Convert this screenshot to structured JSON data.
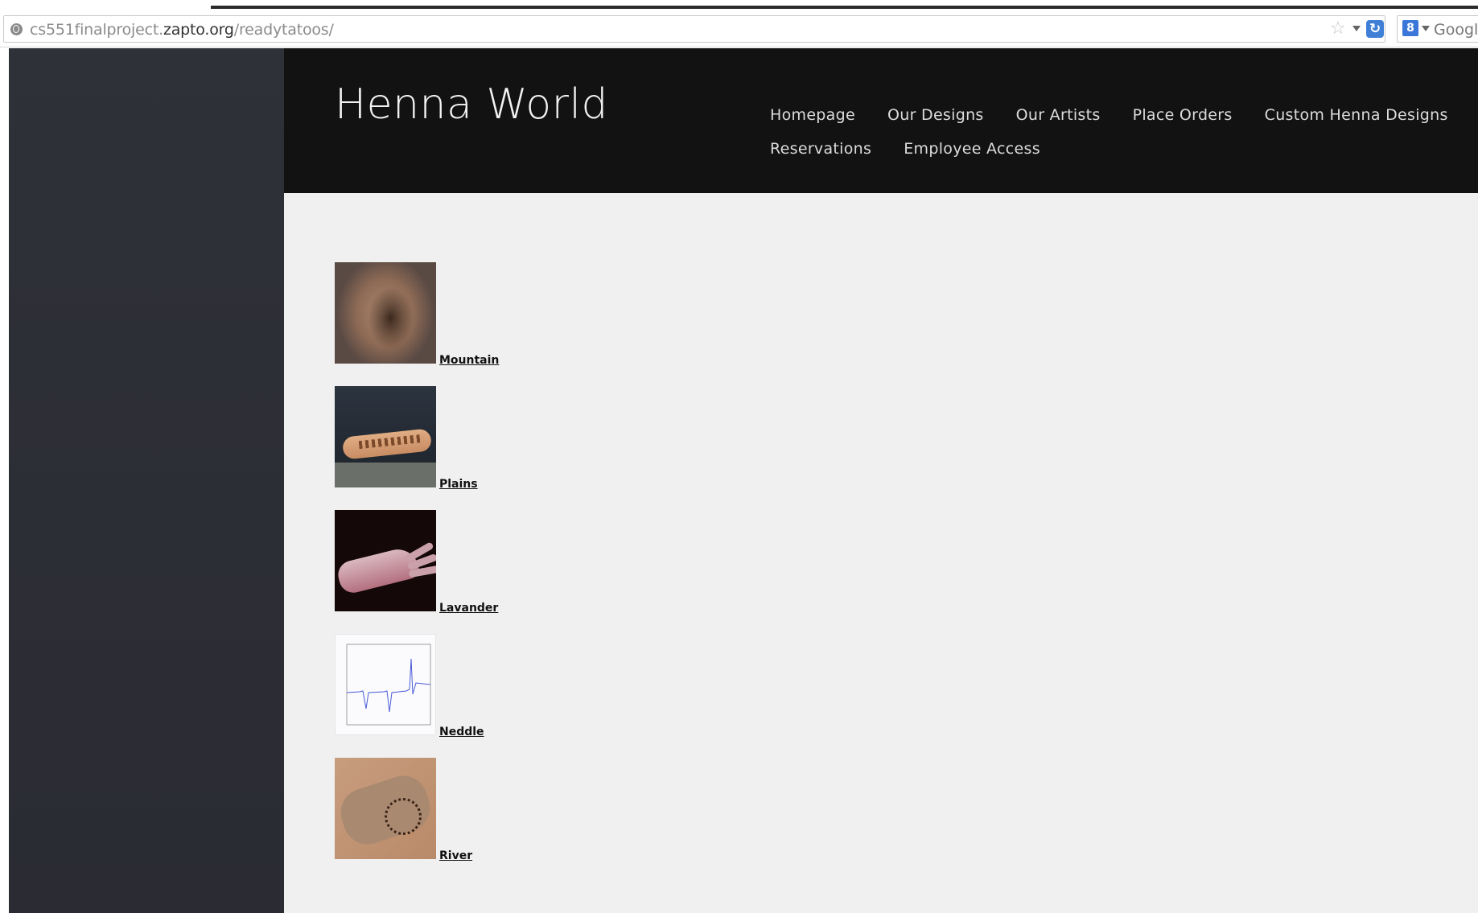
{
  "browser": {
    "url_prefix": "cs551finalproject.",
    "url_host": "zapto.org",
    "url_path": "/readytatoos/",
    "search_placeholder": "Googl"
  },
  "site": {
    "title": "Henna World",
    "nav_row1": [
      "Homepage",
      "Our Designs",
      "Our Artists",
      "Place Orders",
      "Custom Henna Designs"
    ],
    "nav_row2": [
      "Reservations",
      "Employee Access"
    ]
  },
  "designs": [
    {
      "name": "Mountain"
    },
    {
      "name": "Plains"
    },
    {
      "name": "Lavander"
    },
    {
      "name": "Neddle"
    },
    {
      "name": "River"
    }
  ],
  "colors": {
    "header_bg": "#121212",
    "content_bg": "#f0f0f0",
    "left_panel_bg": "#2c2d35",
    "nav_text": "#dcdcdc"
  },
  "icons": {
    "site_info": "globe-icon",
    "bookmark": "star-icon",
    "reload": "reload-icon",
    "search_engine": "google-search-icon"
  }
}
